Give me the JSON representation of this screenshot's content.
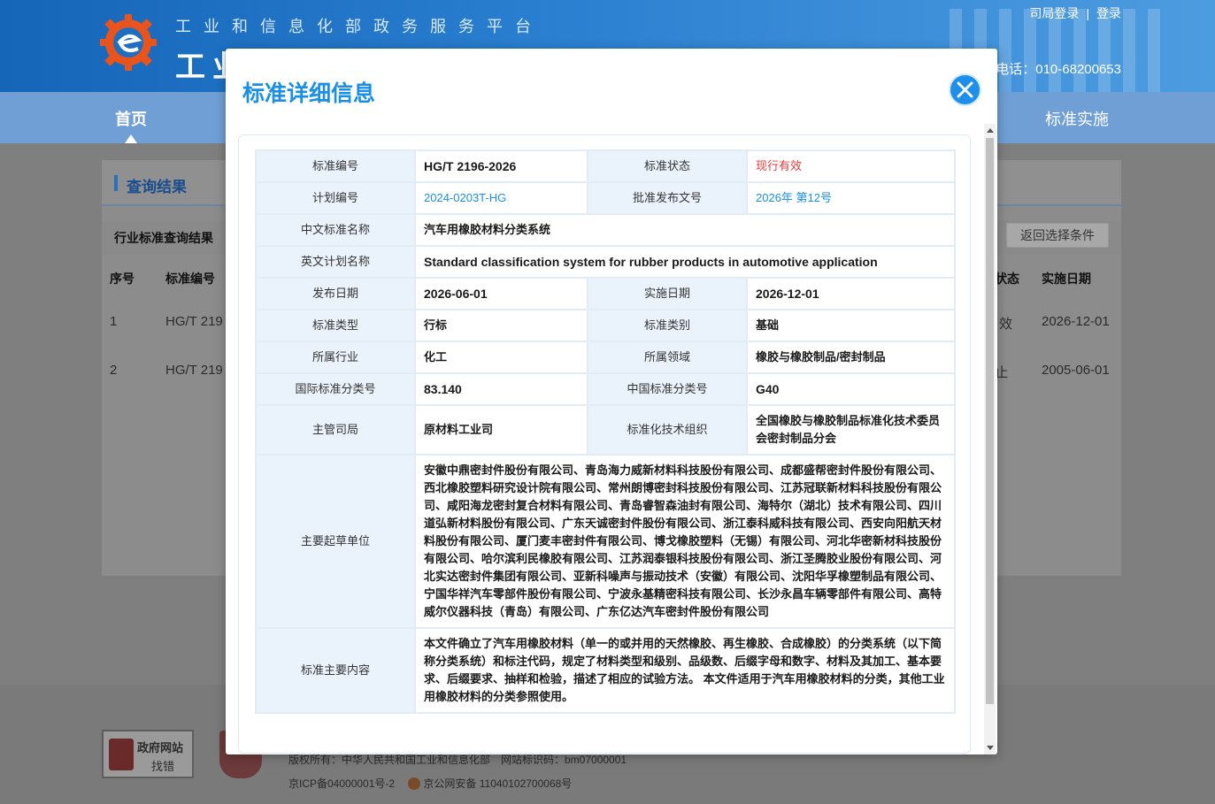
{
  "header": {
    "subtitle": "工业和信息化部政务服务平台",
    "title": "工业",
    "login_dept": "司局登录",
    "login_sep": "|",
    "login": "登录",
    "phone": "电话：010-68200653"
  },
  "nav": {
    "home": "首页",
    "impl": "标准实施"
  },
  "panel": {
    "title": "查询结果",
    "sub_title": "行业标准查询结果",
    "back_button": "返回选择条件",
    "columns": {
      "no": "序号",
      "code": "标准编号",
      "status": "状态",
      "impl_date": "实施日期"
    },
    "rows": [
      {
        "no": "1",
        "code": "HG/T 219",
        "status": "效",
        "impl_date": "2026-12-01"
      },
      {
        "no": "2",
        "code": "HG/T 219",
        "status": "止",
        "impl_date": "2005-06-01"
      }
    ]
  },
  "footer": {
    "gov_badge_top": "政府网站",
    "gov_badge_bottom": "找错",
    "copyright": "版权所有：中华人民共和国工业和信息化部　网站标识码：bm07000001",
    "icp": "京ICP备04000001号-2",
    "police": "京公网安备 11040102700068号"
  },
  "modal": {
    "title": "标准详细信息",
    "fields": {
      "std_no_label": "标准编号",
      "std_no": "HG/T 2196-2026",
      "status_label": "标准状态",
      "status": "现行有效",
      "plan_no_label": "计划编号",
      "plan_no": "2024-0203T-HG",
      "approval_label": "批准发布文号",
      "approval": "2026年 第12号",
      "cn_name_label": "中文标准名称",
      "cn_name": "汽车用橡胶材料分类系统",
      "en_name_label": "英文计划名称",
      "en_name": "Standard classification system for rubber products in automotive application",
      "pub_date_label": "发布日期",
      "pub_date": "2026-06-01",
      "impl_date_label": "实施日期",
      "impl_date": "2026-12-01",
      "type_label": "标准类型",
      "type": "行标",
      "category_label": "标准类别",
      "category": "基础",
      "industry_label": "所属行业",
      "industry": "化工",
      "field_label": "所属领域",
      "field": "橡胶与橡胶制品/密封制品",
      "ics_label": "国际标准分类号",
      "ics": "83.140",
      "ccs_label": "中国标准分类号",
      "ccs": "G40",
      "dept_label": "主管司局",
      "dept": "原材料工业司",
      "tc_label": "标准化技术组织",
      "tc": "全国橡胶与橡胶制品标准化技术委员会密封制品分会",
      "drafters_label": "主要起草单位",
      "drafters": "安徽中鼎密封件股份有限公司、青岛海力威新材料科技股份有限公司、成都盛帮密封件股份有限公司、西北橡胶塑料研究设计院有限公司、常州朗博密封科技股份有限公司、江苏冠联新材料科技股份有限公司、咸阳海龙密封复合材料有限公司、青岛睿智森油封有限公司、海特尔（湖北）技术有限公司、四川道弘新材料股份有限公司、广东天诚密封件股份有限公司、浙江泰科威科技有限公司、西安向阳航天材料股份有限公司、厦门麦丰密封件有限公司、博戈橡胶塑料（无锡）有限公司、河北华密新材科技股份有限公司、哈尔滨利民橡胶有限公司、江苏润泰银科技股份有限公司、浙江圣腾胶业股份有限公司、河北实达密封件集团有限公司、亚新科噪声与振动技术（安徽）有限公司、沈阳华孚橡塑制品有限公司、宁国华祥汽车零部件股份有限公司、宁波永基精密科技有限公司、长沙永昌车辆零部件有限公司、高特威尔仪器科技（青岛）有限公司、广东亿达汽车密封件股份有限公司",
      "content_label": "标准主要内容",
      "content": "本文件确立了汽车用橡胶材料（单一的或并用的天然橡胶、再生橡胶、合成橡胶）的分类系统（以下简称分类系统）和标注代码，规定了材料类型和级别、品级数、后缀字母和数字、材料及其加工、基本要求、后缀要求、抽样和检验，描述了相应的试验方法。 本文件适用于汽车用橡胶材料的分类，其他工业用橡胶材料的分类参照使用。"
    }
  },
  "colors": {
    "accent": "#1a8fe3",
    "status_red": "#e83a3a",
    "label_bg": "#eaf3fc"
  }
}
